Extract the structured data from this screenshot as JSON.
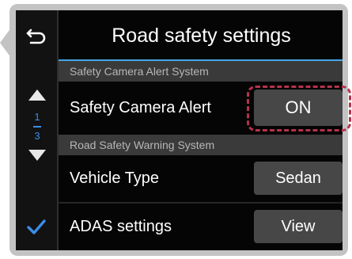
{
  "header": {
    "title": "Road safety settings"
  },
  "sidebar": {
    "back_icon": "back-arrow-icon",
    "up_icon": "triangle-up-icon",
    "down_icon": "triangle-down-icon",
    "check_icon": "checkmark-icon",
    "page_current": "1",
    "page_total": "3",
    "accent_color": "#3b8de6"
  },
  "sections": [
    {
      "header": "Safety Camera Alert System",
      "rows": [
        {
          "label": "Safety Camera Alert",
          "value": "ON",
          "highlighted": true
        }
      ]
    },
    {
      "header": "Road Safety Warning System",
      "rows": [
        {
          "label": "Vehicle Type",
          "value": "Sedan"
        },
        {
          "label": "ADAS settings",
          "value": "View"
        }
      ]
    }
  ],
  "colors": {
    "title_underline": "#46a6e8",
    "highlight_border": "#b4334b",
    "button_bg": "#474747",
    "section_bg": "#3a3a3a"
  }
}
